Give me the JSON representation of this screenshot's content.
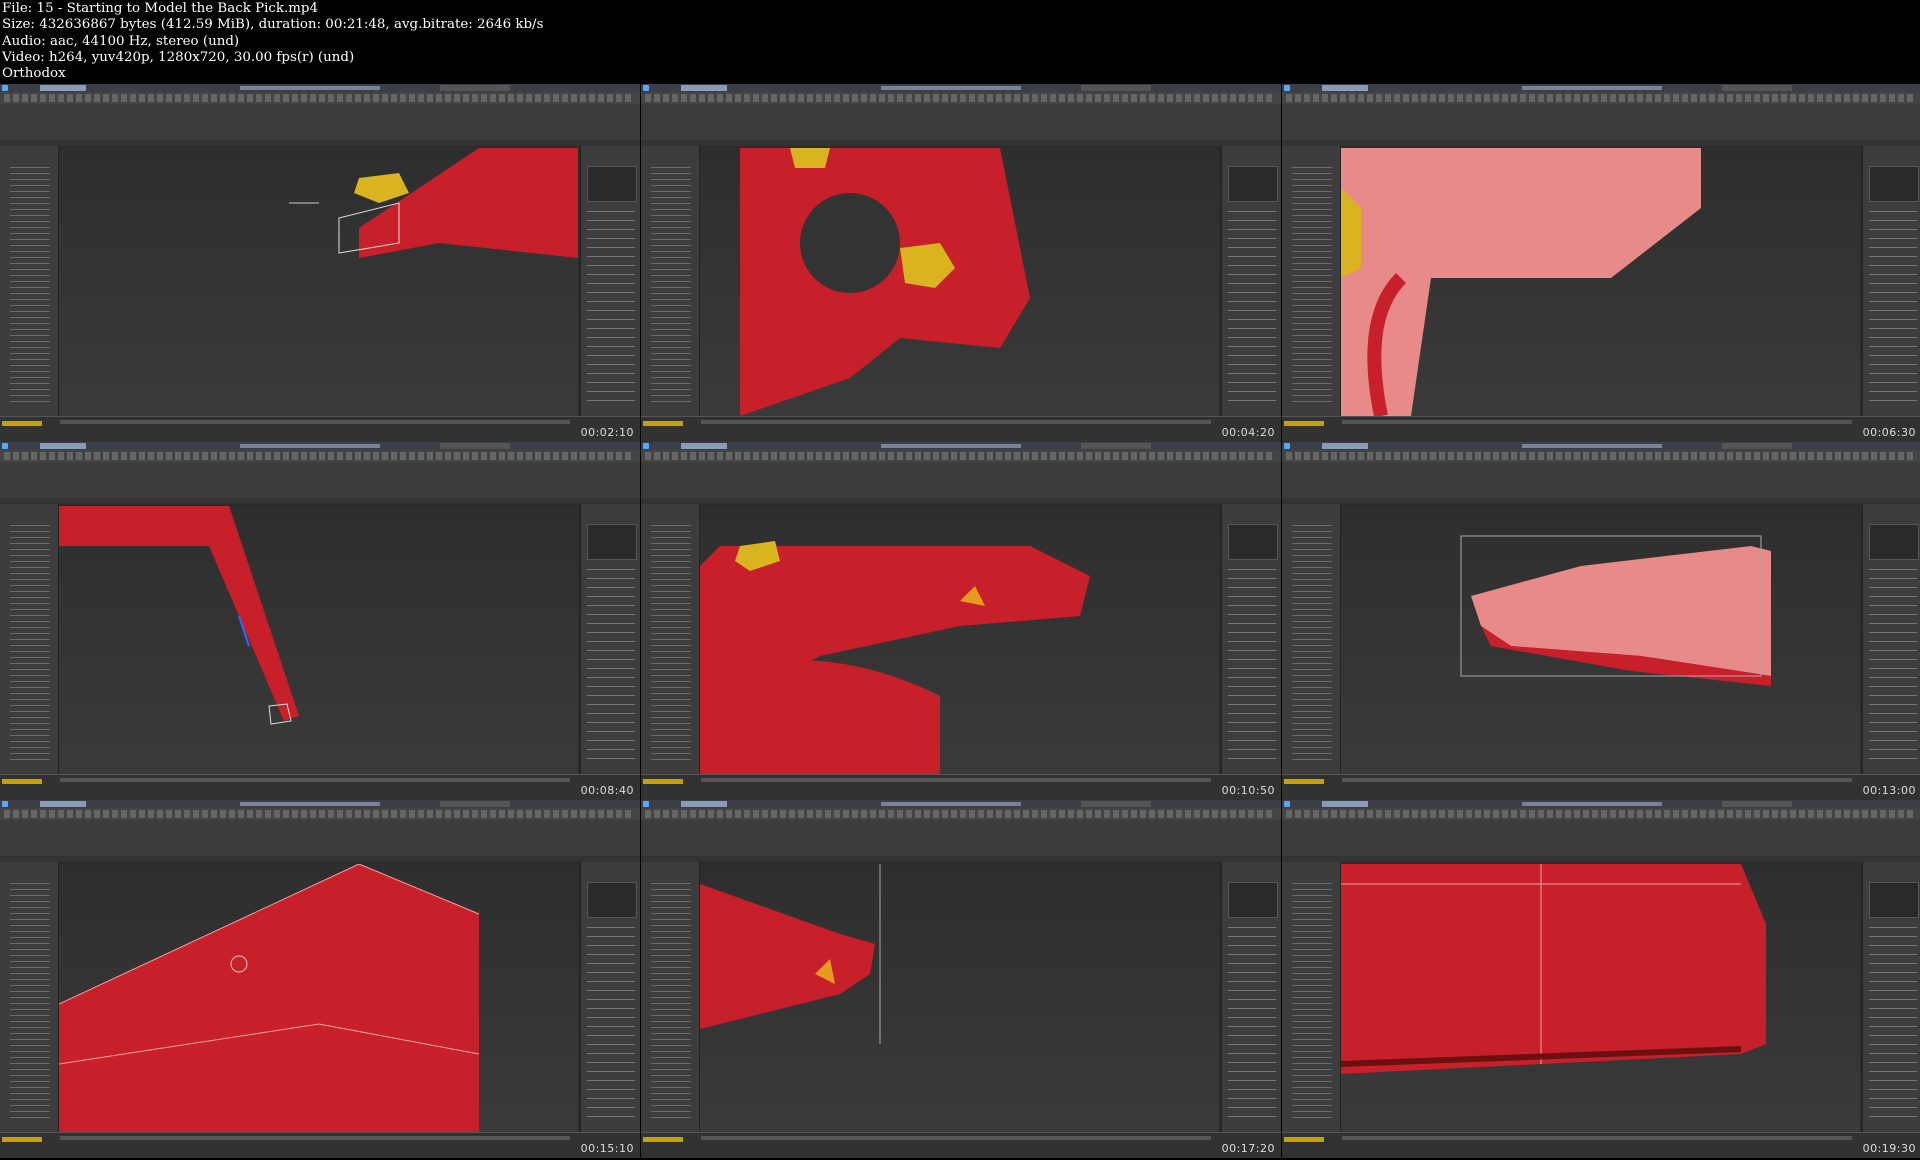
{
  "header": {
    "line1": "File: 15 - Starting to Model the Back Pick.mp4",
    "line2": "Size: 432636867 bytes (412.59 MiB), duration: 00:21:48, avg.bitrate: 2646 kb/s",
    "line3": "Audio: aac, 44100 Hz, stereo (und)",
    "line4": "Video: h264, yuv420p, 1280x720, 30.00 fps(r) (und)",
    "line5": "Orthodox"
  },
  "thumbnails": [
    {
      "timestamp": "00:02:10"
    },
    {
      "timestamp": "00:04:20"
    },
    {
      "timestamp": "00:06:30"
    },
    {
      "timestamp": "00:08:40"
    },
    {
      "timestamp": "00:10:50"
    },
    {
      "timestamp": "00:13:00"
    },
    {
      "timestamp": "00:15:10"
    },
    {
      "timestamp": "00:17:20"
    },
    {
      "timestamp": "00:19:30"
    }
  ],
  "colors": {
    "model_red": "#c8202a",
    "model_selected": "#e88a8a",
    "nut_yellow": "#d9b320",
    "viewport_bg": "#333333",
    "ui_panel": "#3d3d3d"
  }
}
